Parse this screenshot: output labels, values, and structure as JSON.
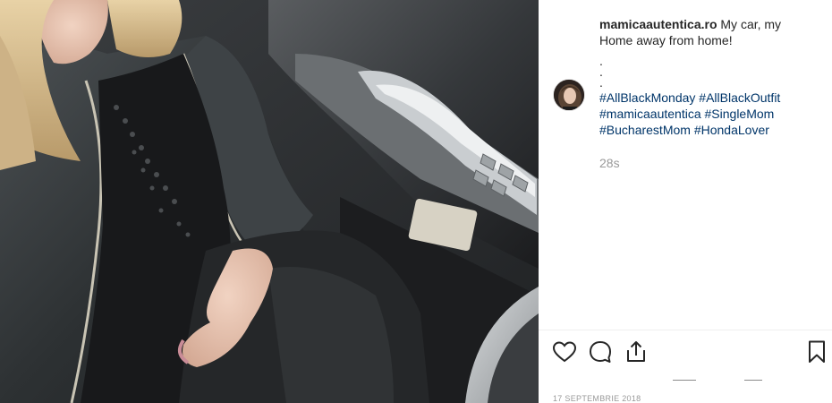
{
  "post": {
    "username": "mamicaautentica.ro",
    "caption_text": "My car, my Home away from home!",
    "caption_dots": [
      ".",
      ".",
      "."
    ],
    "hashtags": [
      "#AllBlackMonday",
      "#AllBlackOutfit",
      "#mamicaautentica",
      "#SingleMom",
      "#BucharestMom",
      "#HondaLover"
    ],
    "time_ago": "28s",
    "date": "17 SEPTEMBRIE 2018"
  },
  "icons": {
    "like": "heart-icon",
    "comment": "comment-bubble-icon",
    "share": "share-icon",
    "save": "bookmark-icon"
  },
  "colors": {
    "text": "#262626",
    "hashtag": "#003569",
    "muted": "#999999",
    "divider": "#efefef"
  }
}
